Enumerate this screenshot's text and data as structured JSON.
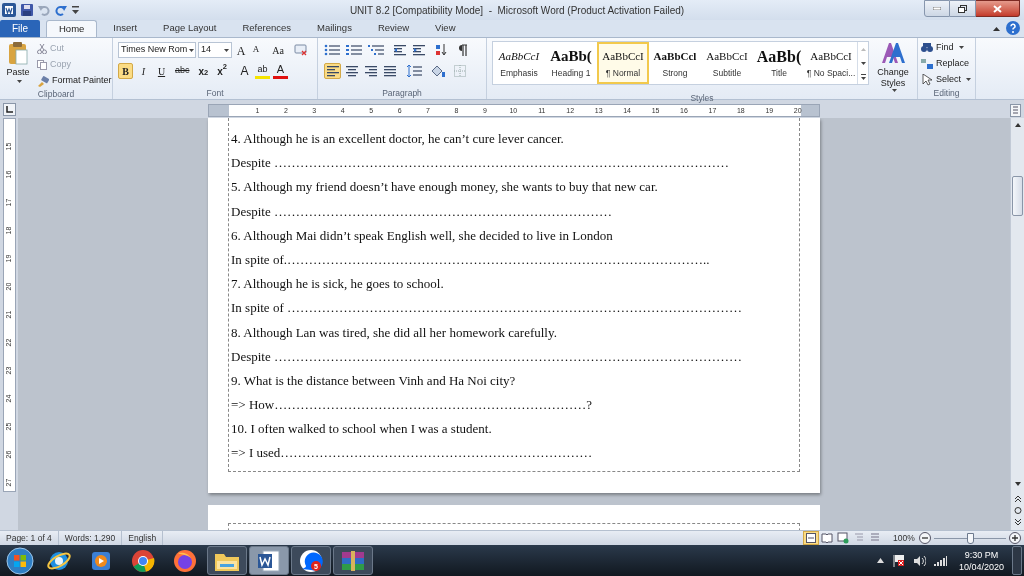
{
  "title_bar": {
    "title": "UNIT 8.2 [Compatibility Mode]  -  Microsoft Word (Product Activation Failed)"
  },
  "tabs": [
    {
      "label": "File",
      "kind": "file",
      "selected": false
    },
    {
      "label": "Home",
      "kind": "tab",
      "selected": true
    },
    {
      "label": "Insert",
      "kind": "tab",
      "selected": false
    },
    {
      "label": "Page Layout",
      "kind": "tab",
      "selected": false
    },
    {
      "label": "References",
      "kind": "tab",
      "selected": false
    },
    {
      "label": "Mailings",
      "kind": "tab",
      "selected": false
    },
    {
      "label": "Review",
      "kind": "tab",
      "selected": false
    },
    {
      "label": "View",
      "kind": "tab",
      "selected": false
    }
  ],
  "clipboard": {
    "paste": "Paste",
    "items": [
      {
        "label": "Cut",
        "kind": "cut",
        "disabled": true
      },
      {
        "label": "Copy",
        "kind": "copy",
        "disabled": true
      },
      {
        "label": "Format Painter",
        "kind": "painter",
        "disabled": false
      }
    ],
    "group": "Clipboard"
  },
  "font": {
    "name": "Times New Rom",
    "size": "14",
    "tools": [
      {
        "kind": "grow",
        "label": "A"
      },
      {
        "kind": "shrink",
        "label": "A"
      },
      {
        "kind": "case",
        "label": "Aa"
      }
    ],
    "formats": [
      {
        "kind": "bold",
        "label": "B",
        "on": true
      },
      {
        "kind": "italic",
        "label": "I",
        "on": false
      },
      {
        "kind": "underline",
        "label": "U",
        "on": false
      },
      {
        "kind": "strike",
        "label": "abc",
        "on": false
      },
      {
        "kind": "subscript",
        "label": "x$_{2}$",
        "on": false
      },
      {
        "kind": "superscript",
        "label": "x$^{2}$",
        "on": false
      },
      {
        "kind": "effects",
        "label": "A"
      },
      {
        "kind": "highlight",
        "label": "ab"
      },
      {
        "kind": "color",
        "label": "A"
      }
    ],
    "group": "Font"
  },
  "paragraph": {
    "alignment": [
      {
        "kind": "left",
        "selected": true
      },
      {
        "kind": "center",
        "selected": false
      },
      {
        "kind": "right",
        "selected": false
      },
      {
        "kind": "justify",
        "selected": false
      }
    ],
    "group": "Paragraph"
  },
  "styles": {
    "items": [
      {
        "preview": "AaBbCcI",
        "label": "Emphasis",
        "kind": "emphasis",
        "selected": false
      },
      {
        "preview": "AaBb(",
        "label": "Heading 1",
        "kind": "heading",
        "selected": false
      },
      {
        "preview": "AaBbCcI",
        "label": "¶ Normal",
        "kind": "normal",
        "selected": true
      },
      {
        "preview": "AaBbCcl",
        "label": "Strong",
        "kind": "strong",
        "selected": false
      },
      {
        "preview": "AaBbCcI",
        "label": "Subtitle",
        "kind": "normal",
        "selected": false
      },
      {
        "preview": "AaBb(",
        "label": "Title",
        "kind": "title",
        "selected": false
      },
      {
        "preview": "AaBbCcI",
        "label": "¶ No Spaci...",
        "kind": "normal",
        "selected": false
      }
    ],
    "change": "Change Styles",
    "group": "Styles"
  },
  "editing": {
    "items": [
      {
        "kind": "find",
        "label": "Find",
        "dropdown": true
      },
      {
        "kind": "replace",
        "label": "Replace",
        "dropdown": false
      },
      {
        "kind": "select",
        "label": "Select",
        "dropdown": true
      }
    ],
    "group": "Editing"
  },
  "ruler": {
    "numbers": [
      "1",
      "2",
      "3",
      "4",
      "5",
      "6",
      "7",
      "8",
      "9",
      "10",
      "11",
      "12",
      "13",
      "14",
      "15",
      "16",
      "17",
      "18",
      "19",
      "20"
    ]
  },
  "vertical_ruler": {
    "numbers": [
      "15",
      "16",
      "17",
      "18",
      "19",
      "20",
      "21",
      "22",
      "23",
      "24",
      "25",
      "26",
      "27"
    ]
  },
  "document": {
    "lines": [
      "4. Although he is an excellent doctor, he can’t cure lever cancer.",
      "Despite ……………………………………………………………………………………………",
      "5. Although my friend doesn’t have enough money, she wants to buy that new car.",
      "Despite ……………………………………………………………………",
      "6. Although Mai didn’t speak English well, she decided to live in London",
      "In spite of.……………………………………………………………………………………..",
      "7. Although he is sick, he goes to school.",
      "In spite of ……………………………………………………………………………………………",
      "8. Although Lan was tired, she did all her homework carefully.",
      "Despite ………………………………………………………………………………………………",
      "9. What is the distance between Vinh and Ha Noi city?",
      "=> How………………………………………………………………?",
      "10. I often walked to school when I was a student.",
      "=> I used………………………………………………………………"
    ]
  },
  "status_bar": {
    "page": "Page: 1 of 4",
    "words": "Words: 1,290",
    "language": "English",
    "views": [
      {
        "kind": "print",
        "selected": true
      },
      {
        "kind": "reading",
        "selected": false
      },
      {
        "kind": "web",
        "selected": false
      },
      {
        "kind": "outline",
        "selected": false
      },
      {
        "kind": "draft",
        "selected": false
      }
    ],
    "zoom": "100%",
    "zoom_slider": {
      "level": 0.5
    }
  },
  "taskbar": {
    "apps": [
      {
        "kind": "ie",
        "running": false,
        "selected": false
      },
      {
        "kind": "media",
        "running": false,
        "selected": false
      },
      {
        "kind": "chrome",
        "running": false,
        "selected": false
      },
      {
        "kind": "firefox",
        "running": false,
        "selected": false
      },
      {
        "kind": "explorer",
        "running": true,
        "selected": false
      },
      {
        "kind": "word",
        "running": true,
        "selected": true
      },
      {
        "kind": "zalo",
        "running": true,
        "selected": false,
        "badge": "5"
      },
      {
        "kind": "winrar",
        "running": true,
        "selected": false
      }
    ],
    "clock": {
      "time": "9:30 PM",
      "date": "10/04/2020"
    }
  }
}
